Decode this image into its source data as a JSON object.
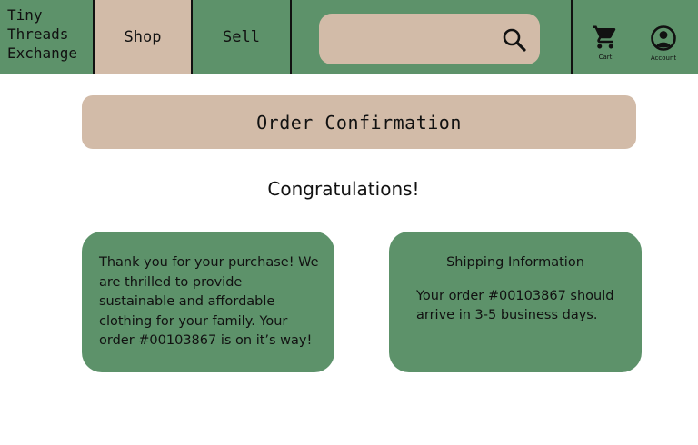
{
  "brand": {
    "lines": [
      "Tiny",
      "Threads",
      "Exchange"
    ]
  },
  "nav": {
    "tabs": [
      {
        "label": "Shop",
        "active": true
      },
      {
        "label": "Sell",
        "active": false
      }
    ]
  },
  "search": {
    "placeholder": "",
    "value": "",
    "icon": "search-icon"
  },
  "icons": {
    "cart": {
      "icon": "cart-icon",
      "label": "Cart"
    },
    "account": {
      "icon": "account-icon",
      "label": "Account"
    }
  },
  "banner": {
    "title": "Order Confirmation"
  },
  "main": {
    "heading": "Congratulations!"
  },
  "cards": {
    "thanks": {
      "text": "Thank you for your purchase! We are thrilled to provide sustainable and affordable clothing for your family. Your order #00103867 is on it’s way!"
    },
    "shipping": {
      "title": "Shipping Information",
      "text": "Your order #00103867 should arrive in 3-5 business days."
    }
  },
  "colors": {
    "primary_green": "#5d926a",
    "accent_tan": "#d2bba8",
    "text": "#111111",
    "background": "#ffffff"
  }
}
